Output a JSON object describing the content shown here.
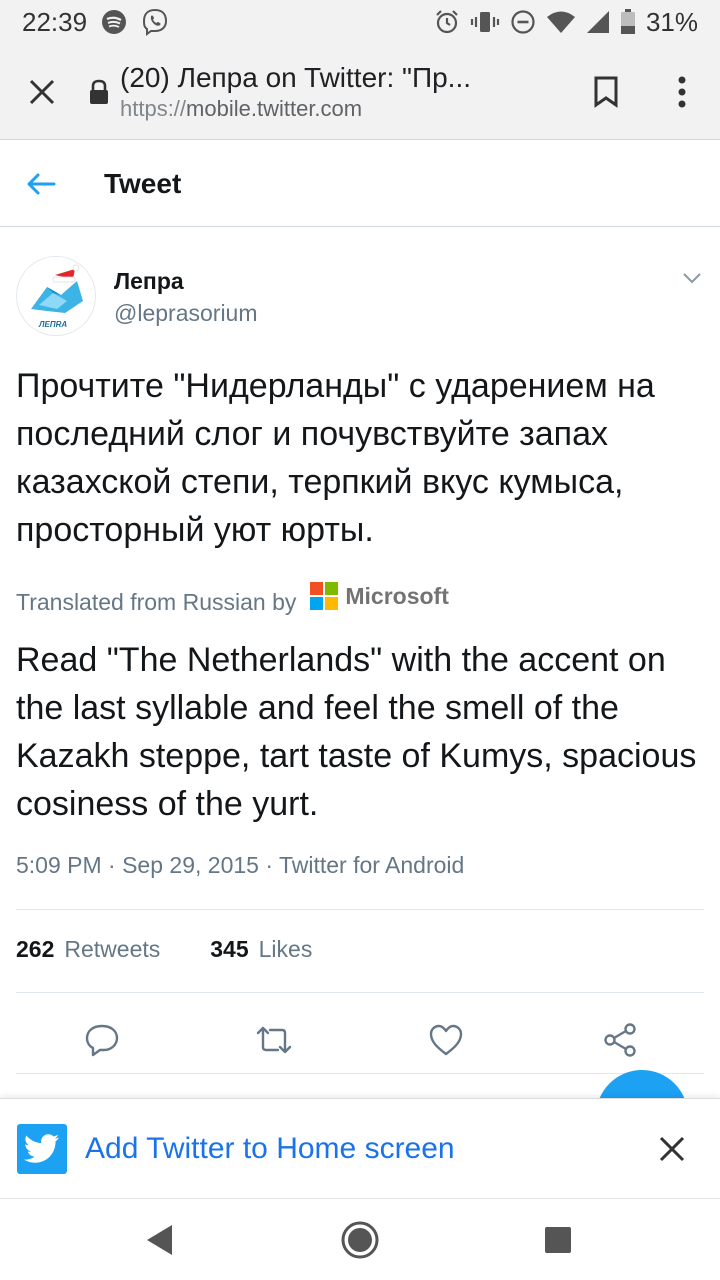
{
  "status_bar": {
    "time": "22:39",
    "battery": "31%"
  },
  "browser": {
    "title": "(20) Лепра on Twitter: \"Пр...",
    "url_scheme": "https://",
    "url_host": "mobile.twitter.com"
  },
  "header": {
    "title": "Tweet"
  },
  "tweet": {
    "author_name": "Лепра",
    "author_handle": "@leprasorium",
    "avatar_label": "ЛЕПRA",
    "text": "Прочтите \"Нидерланды\" с ударением на последний слог и почувствуйте запах казахской степи, терпкий вкус кумыса, просторный уют юрты.",
    "translated_label": "Translated from Russian by",
    "translator": "Microsoft",
    "translation": "Read \"The Netherlands\" with the accent on the last syllable and feel the smell of the Kazakh steppe, tart taste of Kumys, spacious cosiness of the yurt.",
    "meta": "5:09 PM · Sep 29, 2015 · Twitter for Android",
    "retweets_count": "262",
    "retweets_label": "Retweets",
    "likes_count": "345",
    "likes_label": "Likes"
  },
  "home_banner": {
    "text": "Add Twitter to Home screen"
  },
  "colors": {
    "twitter_blue": "#1da1f2",
    "link_blue": "#1a73e8",
    "secondary_text": "#657786",
    "microsoft_red": "#f25022",
    "microsoft_green": "#7fba00",
    "microsoft_blue": "#00a4ef",
    "microsoft_yellow": "#ffb900"
  },
  "icons": {
    "status": [
      "spotify-icon",
      "viber-icon",
      "alarm-icon",
      "vibrate-icon",
      "dnd-icon",
      "wifi-icon",
      "signal-icon",
      "battery-icon"
    ],
    "actions": [
      "reply-icon",
      "retweet-icon",
      "like-icon",
      "share-icon"
    ]
  }
}
